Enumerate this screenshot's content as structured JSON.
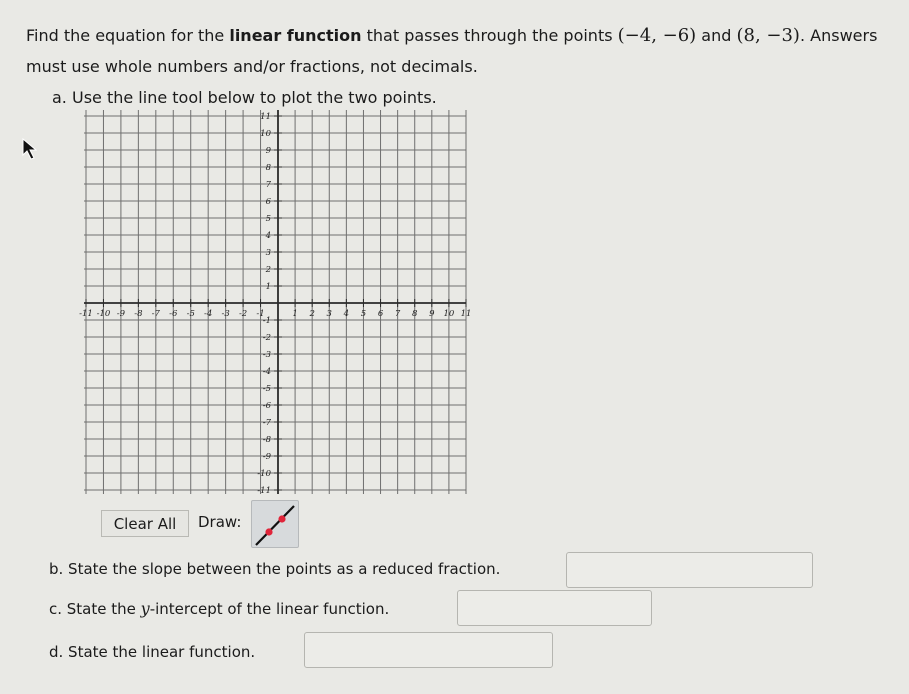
{
  "problem": {
    "intro": "Find the equation for the ",
    "bold_term": "linear function",
    "mid": " that passes through the points ",
    "point1": "(−4, −6)",
    "and": " and ",
    "point2": "(8, −3)",
    "outro": ". Answers must use whole numbers and/or fractions, not decimals."
  },
  "part_a": {
    "label": "a. Use the line tool below to plot the two points."
  },
  "graph": {
    "x_range": [
      -11,
      11
    ],
    "y_range": [
      -11,
      11
    ],
    "x_tick_labels": [
      "-11",
      "-10",
      "-9",
      "-8",
      "-7",
      "-6",
      "-5",
      "-4",
      "-3",
      "-2",
      "-1",
      "1",
      "2",
      "3",
      "4",
      "5",
      "6",
      "7",
      "8",
      "9",
      "10",
      "11"
    ],
    "y_tick_labels": [
      "11",
      "10",
      "9",
      "8",
      "7",
      "6",
      "5",
      "4",
      "3",
      "2",
      "1",
      "-1",
      "-2",
      "-3",
      "-4",
      "-5",
      "-6",
      "-7",
      "-8",
      "-9",
      "-10",
      "-11"
    ],
    "grid": true,
    "grid_color": "#6f6f6f",
    "axis_color": "#2a2a2a"
  },
  "toolbar": {
    "clear_label": "Clear All",
    "draw_label": "Draw:",
    "tool_icon": "line-tool-icon",
    "tool_point_color": "#e0253a"
  },
  "part_b": {
    "label": "b. State the slope between the points as a reduced fraction.",
    "value": ""
  },
  "part_c": {
    "label_pre": "c. State the ",
    "label_var": "y",
    "label_post": "-intercept of the linear function.",
    "value": ""
  },
  "part_d": {
    "label": "d. State the linear function.",
    "value": ""
  }
}
